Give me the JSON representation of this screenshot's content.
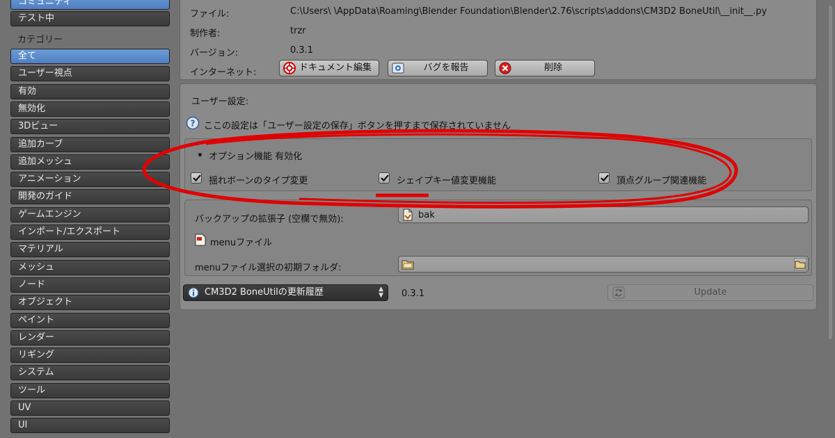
{
  "sidebar": {
    "top_items": [
      "コミュニティ",
      "テスト中"
    ],
    "category_label": "カテゴリー",
    "categories": [
      "全て",
      "ユーザー視点",
      "有効",
      "無効化",
      "3Dビュー",
      "追加カーブ",
      "追加メッシュ",
      "アニメーション",
      "開発のガイド",
      "ゲームエンジン",
      "インポート/エクスポート",
      "マテリアル",
      "メッシュ",
      "ノード",
      "オブジェクト",
      "ペイント",
      "レンダー",
      "リギング",
      "システム",
      "ツール",
      "UV",
      "UI"
    ],
    "active_category": "全て"
  },
  "addon_info": {
    "file_label": "ファイル:",
    "file_value": "C:\\Users\\        \\AppData\\Roaming\\Blender Foundation\\Blender\\2.76\\scripts\\addons\\CM3D2 BoneUtil\\__init__.py",
    "author_label": "制作者:",
    "author_value": "trzr",
    "version_label": "バージョン:",
    "version_value": "0.3.1",
    "internet_label": "インターネット:",
    "buttons": {
      "docs": "ドキュメント編集",
      "report": "バグを報告",
      "remove": "削除"
    }
  },
  "prefs": {
    "title": "ユーザー設定:",
    "notice": "ここの設定は「ユーザー設定の保存」ボタンを押すまで保存されていません",
    "options_header": "オプション機能 有効化",
    "checkboxes": [
      {
        "label": "揺れボーンのタイプ変更",
        "checked": true
      },
      {
        "label": "シェイプキー値変更機能",
        "checked": true
      },
      {
        "label": "頂点グループ関連機能",
        "checked": true
      }
    ],
    "backup_label": "バックアップの拡張子 (空欄で無効):",
    "backup_value": "bak",
    "menu_file_label": "menuファイル",
    "menu_folder_label": "menuファイル選択の初期フォルダ:",
    "menu_folder_value": ""
  },
  "updater": {
    "history_select": "CM3D2 BoneUtilの更新履歴",
    "version": "0.3.1",
    "update_button": "Update"
  },
  "colors": {
    "background": "#727272",
    "active_category": "#5a8ad0",
    "annotation_red": "#e00000"
  },
  "icons": [
    "info-icon",
    "help-icon",
    "docs-icon",
    "bug-report-icon",
    "remove-icon",
    "file-icon",
    "folder-icon",
    "refresh-icon",
    "checkmark-icon"
  ]
}
